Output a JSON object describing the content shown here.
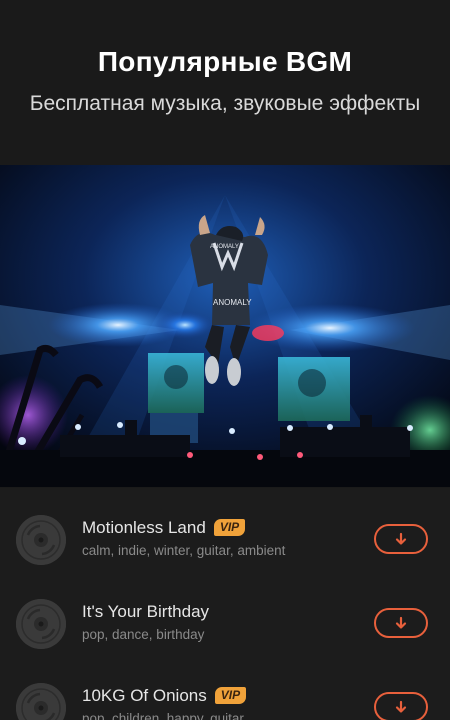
{
  "header": {
    "title": "Популярные BGM",
    "subtitle": "Бесплатная музыка, звуковые эффекты"
  },
  "hero": {
    "jacket_text_back": "ANOMALY",
    "jacket_text_sleeve": "ANOMALY"
  },
  "tracks": [
    {
      "name": "Motionless Land",
      "vip": "VIP",
      "tags": "calm, indie, winter, guitar, ambient"
    },
    {
      "name": "It's Your Birthday",
      "vip": "",
      "tags": "pop, dance, birthday"
    },
    {
      "name": "10KG Of Onions",
      "vip": "VIP",
      "tags": "pop, children, happy, guitar"
    }
  ],
  "colors": {
    "accent": "#e8603c",
    "vip": "#f0a23a"
  },
  "icons": {
    "track": "music-disc-icon",
    "download": "download-arrow-icon"
  }
}
